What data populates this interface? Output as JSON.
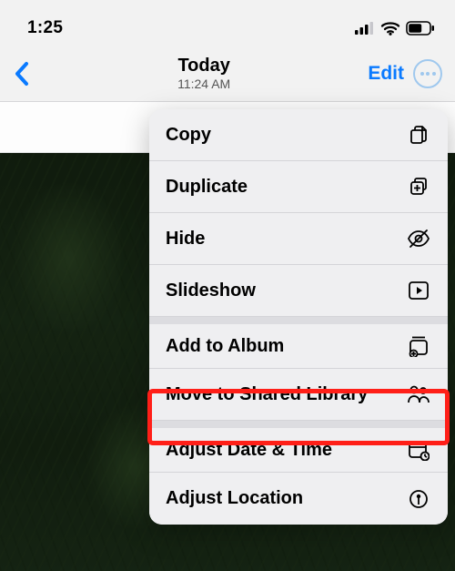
{
  "status": {
    "time": "1:25"
  },
  "nav": {
    "title": "Today",
    "subtitle": "11:24 AM",
    "edit_label": "Edit"
  },
  "menu": {
    "copy": "Copy",
    "duplicate": "Duplicate",
    "hide": "Hide",
    "slideshow": "Slideshow",
    "add_to_album": "Add to Album",
    "move_to_shared": "Move to Shared Library",
    "adjust_date_time": "Adjust Date & Time",
    "adjust_location": "Adjust Location"
  },
  "highlight": "move_to_shared"
}
